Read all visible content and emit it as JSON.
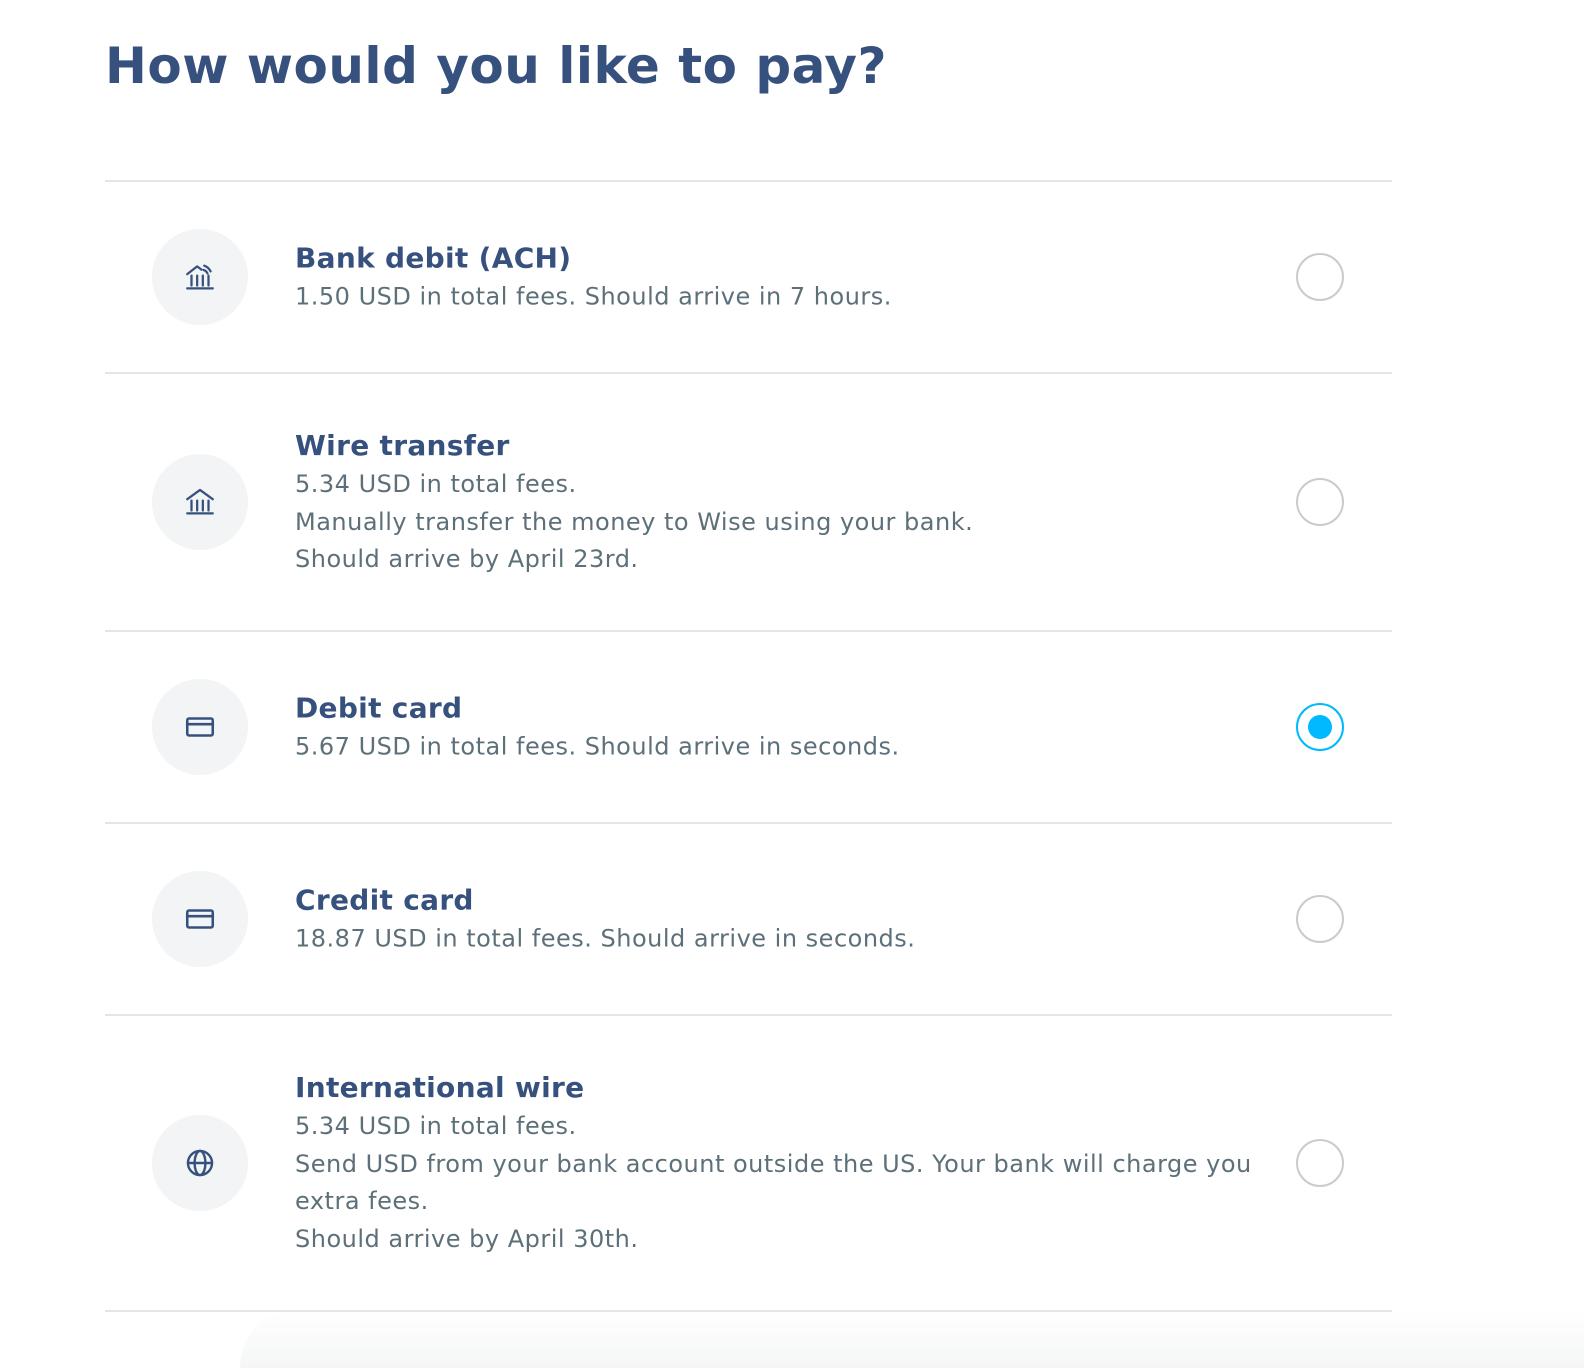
{
  "page": {
    "title": "How would you like to pay?"
  },
  "colors": {
    "title": "#37517e",
    "description": "#5d7079",
    "divider": "#e2e6e8",
    "icon_bg": "#f2f4f5",
    "radio_border": "#c9cbce",
    "radio_selected": "#00b9ff"
  },
  "options": [
    {
      "title": "Bank debit (ACH)",
      "icon": "bank-fast-icon",
      "description": [
        "1.50 USD in total fees. Should arrive in 7 hours."
      ],
      "selected": false
    },
    {
      "title": "Wire transfer",
      "icon": "bank-icon",
      "description": [
        "5.34 USD in total fees.",
        "Manually transfer the money to Wise using your bank.",
        "Should arrive by April 23rd."
      ],
      "selected": false
    },
    {
      "title": "Debit card",
      "icon": "card-icon",
      "description": [
        "5.67 USD in total fees. Should arrive in seconds."
      ],
      "selected": true
    },
    {
      "title": "Credit card",
      "icon": "card-icon",
      "description": [
        "18.87 USD in total fees. Should arrive in seconds."
      ],
      "selected": false
    },
    {
      "title": "International wire",
      "icon": "globe-icon",
      "description": [
        "5.34 USD in total fees.",
        "Send USD from your bank account outside the US. Your bank will charge you extra fees.",
        "Should arrive by April 30th."
      ],
      "selected": false
    }
  ]
}
